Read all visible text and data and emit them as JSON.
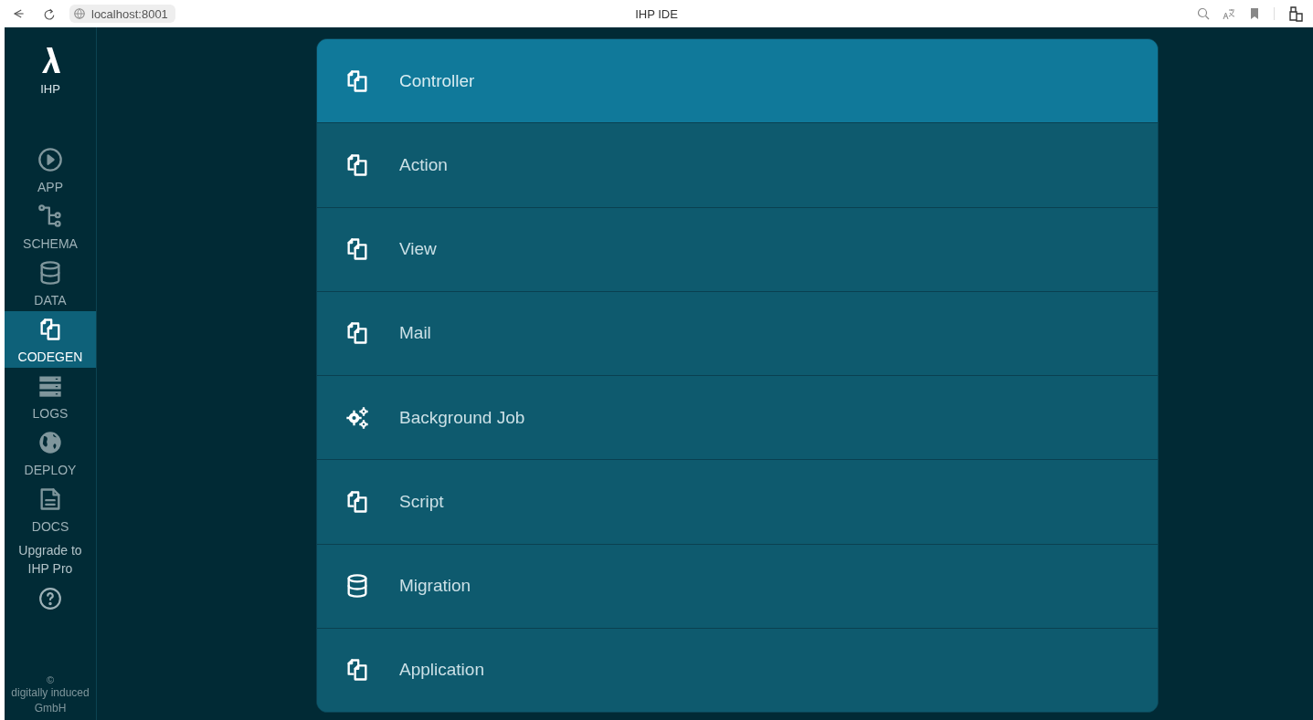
{
  "browser": {
    "url": "localhost:8001",
    "title": "IHP IDE"
  },
  "sidebar": {
    "logo": {
      "label": "IHP"
    },
    "items": [
      {
        "label": "APP",
        "selected": false
      },
      {
        "label": "SCHEMA",
        "selected": false
      },
      {
        "label": "DATA",
        "selected": false
      },
      {
        "label": "CODEGEN",
        "selected": true
      },
      {
        "label": "LOGS",
        "selected": false
      },
      {
        "label": "DEPLOY",
        "selected": false
      },
      {
        "label": "DOCS",
        "selected": false
      }
    ],
    "upgrade_link": "Upgrade to IHP Pro",
    "footer": {
      "symbol": "©",
      "text": "digitally induced GmbH"
    }
  },
  "generators": [
    {
      "label": "Controller",
      "selected": true
    },
    {
      "label": "Action",
      "selected": false
    },
    {
      "label": "View",
      "selected": false
    },
    {
      "label": "Mail",
      "selected": false
    },
    {
      "label": "Background Job",
      "selected": false
    },
    {
      "label": "Script",
      "selected": false
    },
    {
      "label": "Migration",
      "selected": false
    },
    {
      "label": "Application",
      "selected": false
    }
  ]
}
